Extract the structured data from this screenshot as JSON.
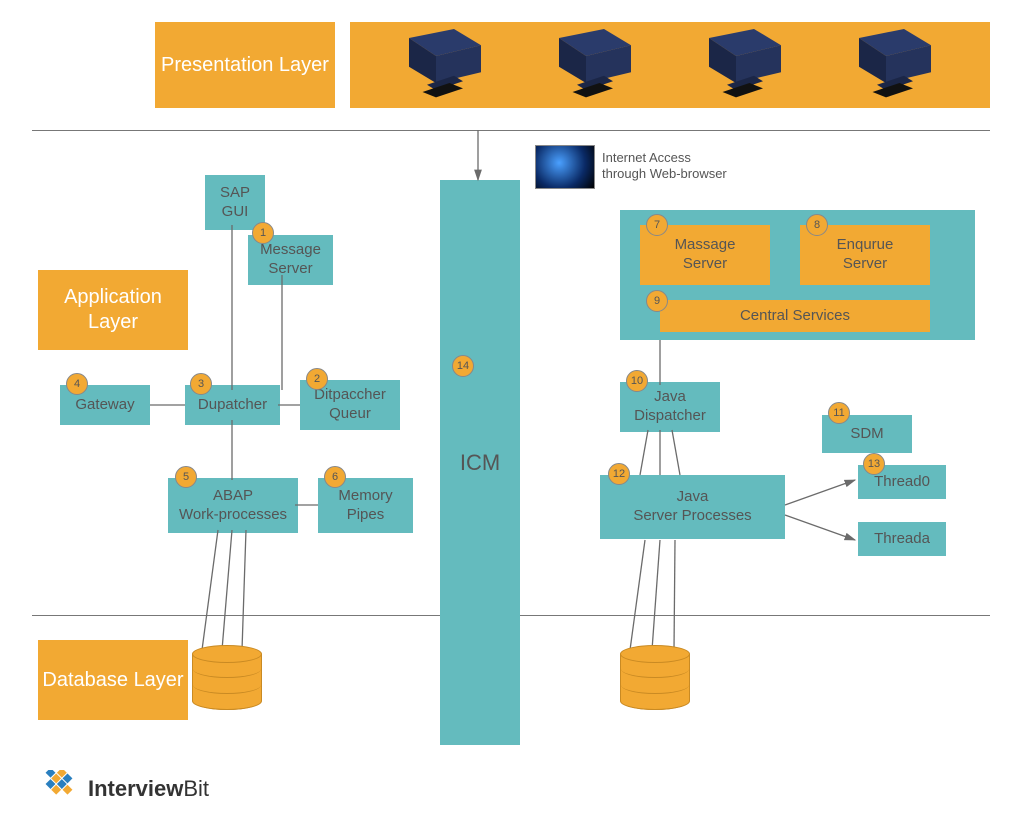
{
  "layers": {
    "presentation": "Presentation Layer",
    "application": "Application Layer",
    "database": "Database Layer"
  },
  "internet": {
    "line1": "Internet Access",
    "line2": "through Web-browser"
  },
  "nodes": {
    "sap_gui": "SAP\nGUI",
    "message_server": "Message\nServer",
    "dispatcher": "Dupatcher",
    "dispatcher_queue": "Ditpaccher\nQueur",
    "gateway": "Gateway",
    "abap_wp": "ABAP\nWork-processes",
    "memory_pipes": "Memory\nPipes",
    "icm": "ICM",
    "massage_server": "Massage\nServer",
    "enqueue_server": "Enqurue\nServer",
    "central_services": "Central Services",
    "java_dispatcher": "Java\nDispatcher",
    "sdm": "SDM",
    "java_server_processes": "Java\nServer Processes",
    "thread0": "Thread0",
    "threada": "Threada"
  },
  "badges": {
    "b1": "1",
    "b2": "2",
    "b3": "3",
    "b4": "4",
    "b5": "5",
    "b6": "6",
    "b7": "7",
    "b8": "8",
    "b9": "9",
    "b10": "10",
    "b11": "11",
    "b12": "12",
    "b13": "13",
    "b14": "14"
  },
  "brand": {
    "name": "Interview",
    "suffix": "Bit"
  },
  "colors": {
    "orange": "#f2a933",
    "teal": "#64bbbe",
    "line": "#6b6b6b"
  }
}
